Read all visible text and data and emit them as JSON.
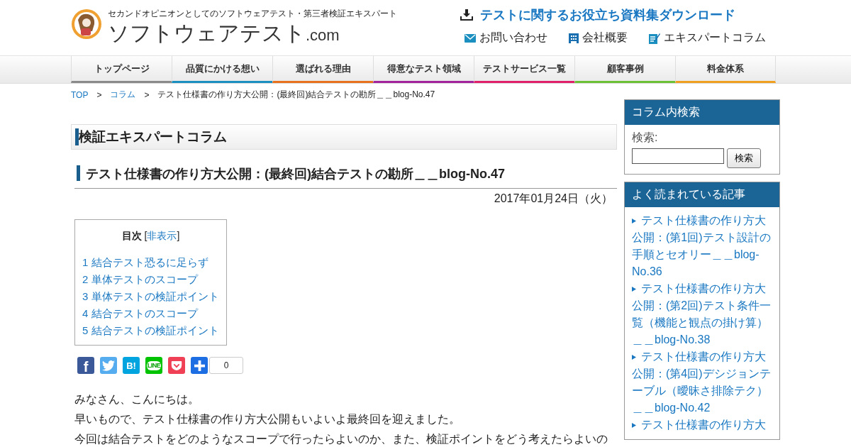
{
  "site": {
    "tagline": "セカンドオピニオンとしてのソフトウェアテスト・第三者検証エキスパート",
    "title": "ソフトウェアテスト",
    "title_suffix": ".com"
  },
  "header": {
    "download": "テストに関するお役立ち資料集ダウンロード",
    "links": [
      {
        "kind": "mail",
        "label": "お問い合わせ"
      },
      {
        "kind": "company",
        "label": "会社概要"
      },
      {
        "kind": "column",
        "label": "エキスパートコラム"
      }
    ]
  },
  "nav": [
    {
      "label": "トップページ",
      "color": "#8a8a8a"
    },
    {
      "label": "品質にかける想い",
      "color": "#1a8fc0"
    },
    {
      "label": "選ばれる理由",
      "color": "#e8711e"
    },
    {
      "label": "得意なテスト領域",
      "color": "#a3239d"
    },
    {
      "label": "テストサービス一覧",
      "color": "#e0206a"
    },
    {
      "label": "顧客事例",
      "color": "#6cc036"
    },
    {
      "label": "料金体系",
      "color": "#f0a020"
    }
  ],
  "breadcrumb": [
    {
      "label": "TOP",
      "link": true
    },
    {
      "label": "コラム",
      "link": true
    },
    {
      "label": "テスト仕様書の作り方大公開：(最終回)結合テストの勘所＿＿blog-No.47",
      "link": false
    }
  ],
  "breadcrumb_separator": ">",
  "section_title": "検証エキスパートコラム",
  "article": {
    "title": "テスト仕様書の作り方大公開：(最終回)結合テストの勘所＿＿blog-No.47",
    "date": "2017年01月24日（火）",
    "toc": {
      "title": "目次",
      "toggle_open": "[",
      "toggle": "非表示",
      "toggle_close": "]",
      "items": [
        "1 結合テスト恐るに足らず",
        "2 単体テストのスコープ",
        "3 単体テストの検証ポイント",
        "4 結合テストのスコープ",
        "5 結合テストの検証ポイント"
      ]
    },
    "share": {
      "buttons": [
        {
          "kind": "facebook",
          "glyph": "f"
        },
        {
          "kind": "twitter"
        },
        {
          "kind": "hatena",
          "glyph": "B!"
        },
        {
          "kind": "line",
          "glyph": "LINE"
        },
        {
          "kind": "pocket"
        },
        {
          "kind": "add"
        }
      ],
      "count": "0"
    },
    "paragraphs": [
      "みなさん、こんにちは。",
      "早いもので、テスト仕様書の作り方大公開もいよいよ最終回を迎えました。",
      "今回は結合テストをどのようなスコープで行ったらよいのか、また、検証ポイントをどう考えたらよいの"
    ]
  },
  "sidebar": {
    "search": {
      "title": "コラム内検索",
      "label": "検索:",
      "button": "検索"
    },
    "popular": {
      "title": "よく読まれている記事",
      "items": [
        "テスト仕様書の作り方大公開：(第1回)テスト設計の手順とセオリー＿＿blog-No.36",
        "テスト仕様書の作り方大公開：(第2回)テスト条件一覧（機能と観点の掛け算）＿＿blog-No.38",
        "テスト仕様書の作り方大公開：(第4回)デシジョンテーブル（曖昧さ排除テク）＿＿blog-No.42",
        "テスト仕様書の作り方大"
      ]
    }
  }
}
